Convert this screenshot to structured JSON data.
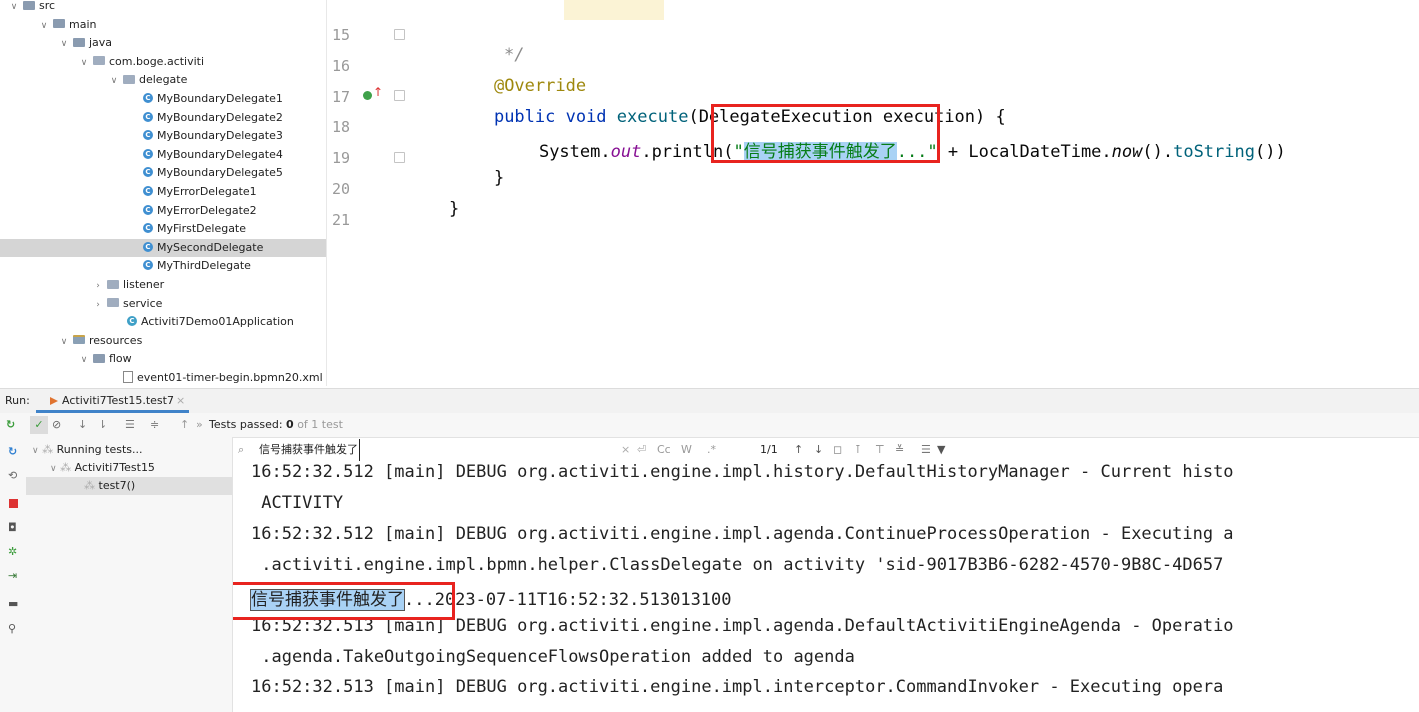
{
  "project_tree": {
    "items": [
      {
        "label": "src",
        "icon": "folder-icon",
        "expanded": true
      },
      {
        "label": "main",
        "icon": "folder-icon",
        "expanded": true
      },
      {
        "label": "java",
        "icon": "folder-icon",
        "expanded": true
      },
      {
        "label": "com.boge.activiti",
        "icon": "package-icon",
        "expanded": true
      },
      {
        "label": "delegate",
        "icon": "package-icon",
        "expanded": true
      },
      {
        "label": "MyBoundaryDelegate1",
        "icon": "class-icon"
      },
      {
        "label": "MyBoundaryDelegate2",
        "icon": "class-icon"
      },
      {
        "label": "MyBoundaryDelegate3",
        "icon": "class-icon"
      },
      {
        "label": "MyBoundaryDelegate4",
        "icon": "class-icon"
      },
      {
        "label": "MyBoundaryDelegate5",
        "icon": "class-icon"
      },
      {
        "label": "MyErrorDelegate1",
        "icon": "class-icon"
      },
      {
        "label": "MyErrorDelegate2",
        "icon": "class-icon"
      },
      {
        "label": "MyFirstDelegate",
        "icon": "class-icon"
      },
      {
        "label": "MySecondDelegate",
        "icon": "class-icon",
        "selected": true
      },
      {
        "label": "MyThirdDelegate",
        "icon": "class-icon"
      },
      {
        "label": "listener",
        "icon": "package-icon",
        "expanded": false
      },
      {
        "label": "service",
        "icon": "package-icon",
        "expanded": false
      },
      {
        "label": "Activiti7Demo01Application",
        "icon": "spring-class-icon"
      },
      {
        "label": "resources",
        "icon": "resources-folder-icon",
        "expanded": true
      },
      {
        "label": "flow",
        "icon": "folder-icon",
        "expanded": true
      },
      {
        "label": "event01-timer-begin.bpmn20.xml",
        "icon": "bpmn-file-icon"
      }
    ]
  },
  "editor": {
    "line_numbers": [
      "15",
      "16",
      "17",
      "18",
      "19",
      "20",
      "21"
    ],
    "code": {
      "l15": "*/",
      "l16": "@Override",
      "l17_kw": "public void",
      "l17_fn": "execute",
      "l17_rest": "(DelegateExecution execution) {",
      "l18_sys": "System.",
      "l18_out": "out",
      "l18_println": ".println(",
      "l18_quote_open": "\"",
      "l18_highlight": "信号捕获事件触发了",
      "l18_str_rest": "...\"",
      "l18_mid": " + LocalDateTime.",
      "l18_now": "now",
      "l18_tail1": "().",
      "l18_tostring": "toString",
      "l18_tail2": "())",
      "l19": "}",
      "l20": "}"
    }
  },
  "run_panel": {
    "run_label": "Run:",
    "tab_label": "Activiti7Test15.test7",
    "tests_passed_label": "Tests passed:",
    "tests_passed_count": "0",
    "tests_passed_suffix": "of 1 test",
    "more_label": "»",
    "test_tree": [
      {
        "label": "Running tests..."
      },
      {
        "label": "Activiti7Test15"
      },
      {
        "label": "test7()",
        "selected": true
      }
    ],
    "search": {
      "query": "信号捕获事件触发了",
      "match_case_label": "Cc",
      "words_label": "W",
      "regex_label": ".*",
      "count": "1/1"
    }
  },
  "console": {
    "lines": [
      "16:52:32.512 [main] DEBUG org.activiti.engine.impl.history.DefaultHistoryManager - Current histo",
      " ACTIVITY",
      "16:52:32.512 [main] DEBUG org.activiti.engine.impl.agenda.ContinueProcessOperation - Executing a",
      " .activiti.engine.impl.bpmn.helper.ClassDelegate on activity 'sid-9017B3B6-6282-4570-9B8C-4D657",
      "",
      "16:52:32.513 [main] DEBUG org.activiti.engine.impl.agenda.DefaultActivitiEngineAgenda - Operatio",
      " .agenda.TakeOutgoingSequenceFlowsOperation added to agenda",
      "16:52:32.513 [main] DEBUG org.activiti.engine.impl.interceptor.CommandInvoker - Executing opera"
    ],
    "match_line_highlight": "信号捕获事件触发了",
    "match_line_rest": "...2023-07-11T16:52:32.513013100"
  },
  "colors": {
    "annotation_box": "#e8231f",
    "selection": "#a9d2f5",
    "keyword": "#0033b3",
    "string": "#067d17"
  }
}
